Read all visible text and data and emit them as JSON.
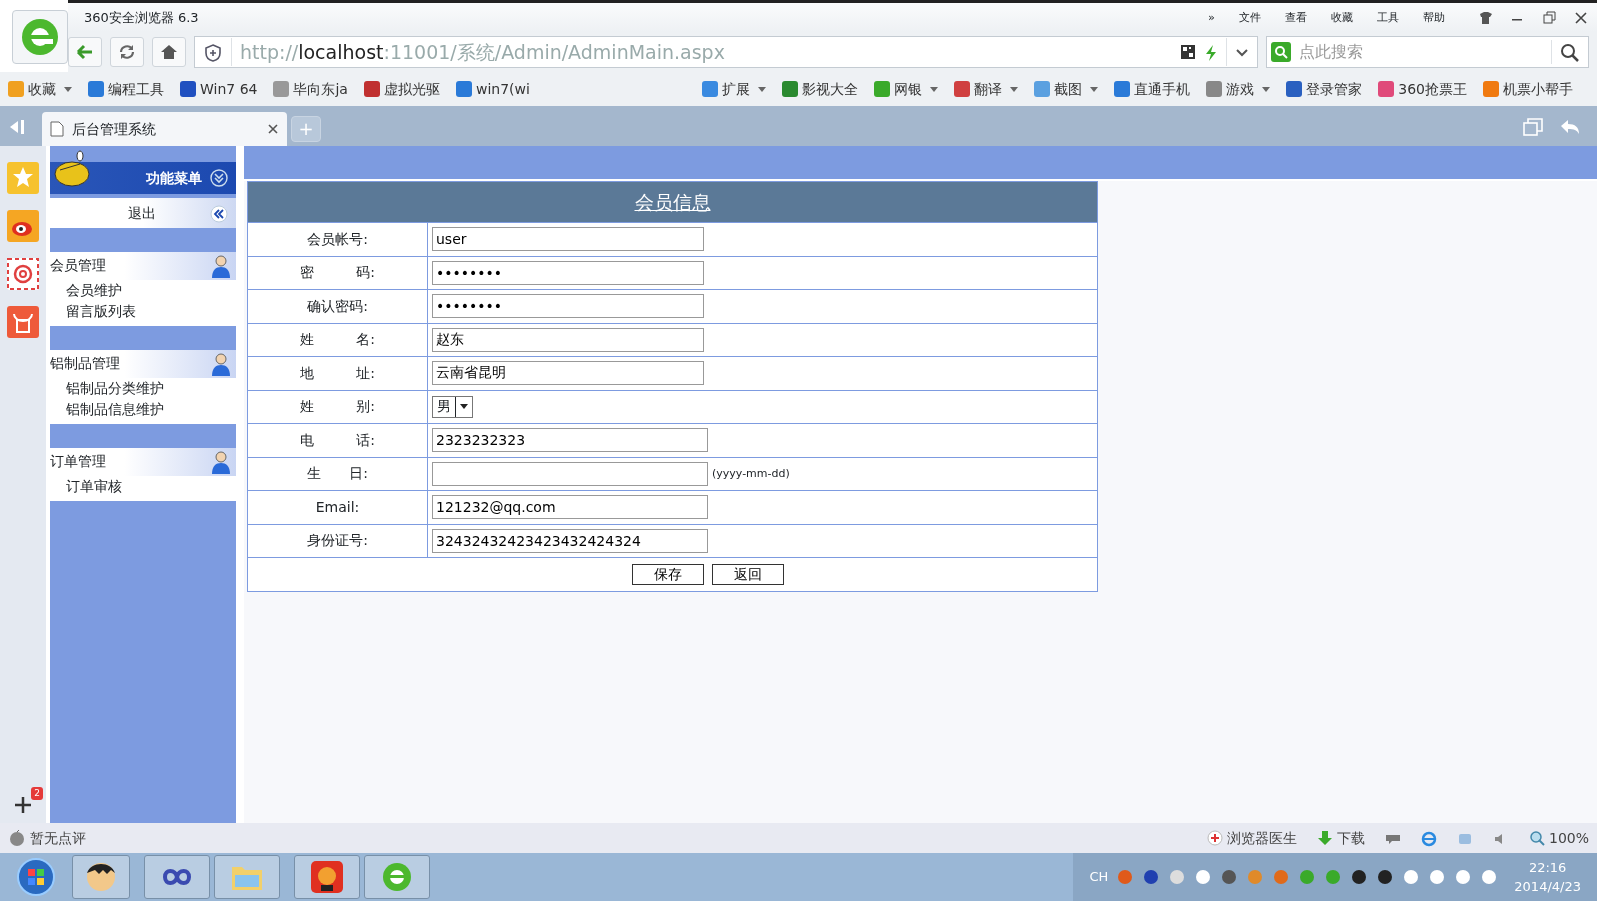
{
  "browser": {
    "title": "360安全浏览器 6.3",
    "menu": [
      "»",
      "文件",
      "查看",
      "收藏",
      "工具",
      "帮助"
    ],
    "url": {
      "scheme": "http://",
      "host": "localhost",
      "path": ":11001/系统/Admin/AdminMain.aspx"
    },
    "search": {
      "placeholder": "点此搜索"
    },
    "bookmarks_left": [
      {
        "label": "收藏",
        "dropdown": true
      },
      {
        "label": "编程工具",
        "dropdown": false
      },
      {
        "label": "Win7 64",
        "dropdown": false
      },
      {
        "label": "毕向东ja",
        "dropdown": false
      },
      {
        "label": "虚拟光驱",
        "dropdown": false
      },
      {
        "label": "win7(wi",
        "dropdown": false
      }
    ],
    "bookmarks_right": [
      {
        "label": "扩展",
        "dropdown": true
      },
      {
        "label": "影视大全",
        "dropdown": false
      },
      {
        "label": "网银",
        "dropdown": true
      },
      {
        "label": "翻译",
        "dropdown": true
      },
      {
        "label": "截图",
        "dropdown": true
      },
      {
        "label": "直通手机",
        "dropdown": false
      },
      {
        "label": "游戏",
        "dropdown": true
      },
      {
        "label": "登录管家",
        "dropdown": false
      },
      {
        "label": "360抢票王",
        "dropdown": false
      },
      {
        "label": "机票小帮手",
        "dropdown": false
      }
    ],
    "tabs": [
      {
        "label": "后台管理系统",
        "selected": true
      }
    ],
    "new_tab": "+",
    "side_badge": "2"
  },
  "menu": {
    "title": "功能菜单",
    "logout": "退出",
    "groups": [
      {
        "title": "会员管理",
        "items": [
          "会员维护",
          "留言版列表"
        ]
      },
      {
        "title": "铝制品管理",
        "items": [
          "铝制品分类维护",
          "铝制品信息维护"
        ]
      },
      {
        "title": "订单管理",
        "items": [
          "订单审核"
        ]
      }
    ]
  },
  "form": {
    "title": "会员信息",
    "fields": [
      {
        "label": "会员帐号:",
        "kind": "text",
        "value": "user"
      },
      {
        "label": "密　　　码:",
        "kind": "text",
        "value": "••••••••"
      },
      {
        "label": "确认密码:",
        "kind": "text",
        "value": "••••••••"
      },
      {
        "label": "姓　　　名:",
        "kind": "text",
        "value": "赵东"
      },
      {
        "label": "地　　　址:",
        "kind": "text",
        "value": "云南省昆明"
      },
      {
        "label": "姓　　　别:",
        "kind": "select",
        "value": "男"
      },
      {
        "label": "电　　　话:",
        "kind": "wide",
        "value": "2323232323"
      },
      {
        "label": "生　　日:",
        "kind": "wide",
        "hint": "(yyyy-mm-dd)"
      },
      {
        "label": "Email:",
        "kind": "wide",
        "value": "121232@qq.com"
      },
      {
        "label": "身份证号:",
        "kind": "wide",
        "value": "32432432423423432424324"
      }
    ],
    "buttons": [
      "保存",
      "返回"
    ]
  },
  "status_bar": {
    "left": "暂无点评",
    "items": [
      "浏览器医生",
      "下载"
    ],
    "zoom": "100%"
  },
  "taskbar": {
    "input": "CH",
    "time": "22:16",
    "date": "2014/4/23"
  }
}
